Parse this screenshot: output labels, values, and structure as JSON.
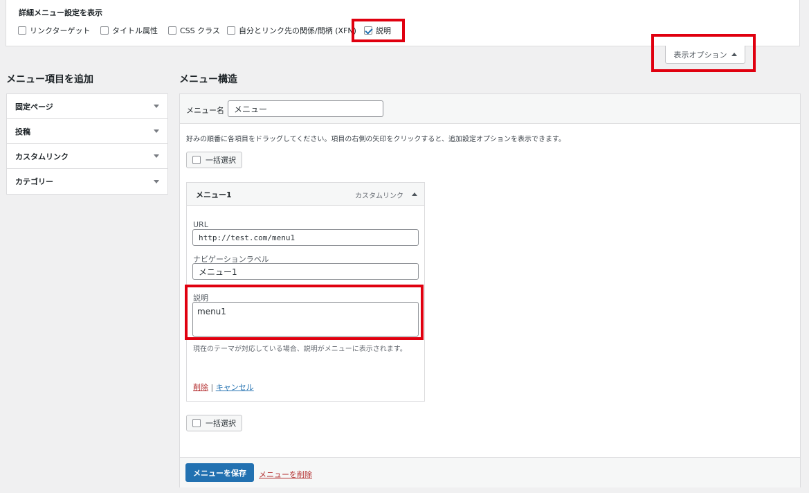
{
  "screen_options": {
    "title": "詳細メニュー設定を表示",
    "options": [
      {
        "label": "リンクターゲット",
        "checked": false
      },
      {
        "label": "タイトル属性",
        "checked": false
      },
      {
        "label": "CSS クラス",
        "checked": false
      },
      {
        "label": "自分とリンク先の関係/間柄 (XFN)",
        "checked": false
      },
      {
        "label": "説明",
        "checked": true
      }
    ],
    "toggle_label": "表示オプション"
  },
  "add_items": {
    "heading": "メニュー項目を追加",
    "sections": [
      "固定ページ",
      "投稿",
      "カスタムリンク",
      "カテゴリー"
    ]
  },
  "menu_structure": {
    "heading": "メニュー構造",
    "menu_name_label": "メニュー名",
    "menu_name_value": "メニュー",
    "instructions": "好みの順番に各項目をドラッグしてください。項目の右側の矢印をクリックすると、追加設定オプションを表示できます。",
    "bulk_select_label": "一括選択",
    "item": {
      "title": "メニュー1",
      "type": "カスタムリンク",
      "url_label": "URL",
      "url_value": "http://test.com/menu1",
      "nav_label_label": "ナビゲーションラベル",
      "nav_label_value": "メニュー1",
      "description_label": "説明",
      "description_value": "menu1",
      "description_help": "現在のテーマが対応している場合、説明がメニューに表示されます。",
      "delete_link": "削除",
      "separator": "|",
      "cancel_link": "キャンセル"
    },
    "save_button": "メニューを保存",
    "delete_menu_link": "メニューを削除"
  },
  "colors": {
    "accent": "#2271b1",
    "highlight": "#e0000f",
    "danger": "#b32d2e"
  }
}
